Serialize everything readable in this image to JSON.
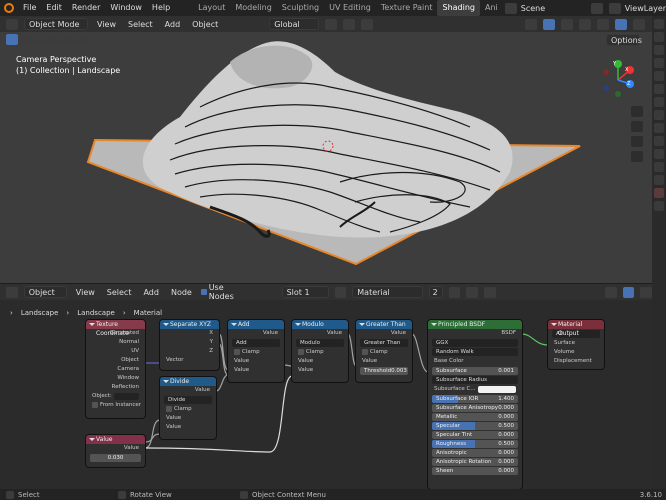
{
  "menubar": {
    "items": [
      "File",
      "Edit",
      "Render",
      "Window",
      "Help"
    ],
    "workspaces": [
      "Layout",
      "Modeling",
      "Sculpting",
      "UV Editing",
      "Texture Paint",
      "Shading",
      "Ani"
    ],
    "active_workspace": "Shading",
    "scene": "Scene",
    "view_layer": "ViewLayer"
  },
  "viewport_header": {
    "mode": "Object Mode",
    "menus": [
      "View",
      "Select",
      "Add",
      "Object"
    ],
    "transform": "Global",
    "options": "Options"
  },
  "viewport": {
    "camera": "Camera Perspective",
    "collection": "(1) Collection | Landscape",
    "gizmo_axes": [
      "X",
      "Y",
      "Z"
    ]
  },
  "node_header": {
    "type": "Object",
    "menus": [
      "View",
      "Select",
      "Add",
      "Node"
    ],
    "use_nodes": "Use Nodes",
    "slot": "Slot 1",
    "material": "Material",
    "users": "2"
  },
  "breadcrumb": [
    "Landscape",
    "Landscape",
    "Material"
  ],
  "nodes": {
    "texcoord": {
      "title": "Texture Coordinate",
      "outputs": [
        "Generated",
        "Normal",
        "UV",
        "Object",
        "Camera",
        "Window",
        "Reflection"
      ],
      "object_label": "Object:",
      "from_instancer": "From Instancer"
    },
    "sepxyz": {
      "title": "Separate XYZ",
      "outputs": [
        "X",
        "Y",
        "Z"
      ],
      "input": "Vector"
    },
    "divide": {
      "title": "Divide",
      "output": "Value",
      "op": "Divide",
      "clamp": "Clamp",
      "inputs": [
        "Value",
        "Value"
      ]
    },
    "add": {
      "title": "Add",
      "output": "Value",
      "op": "Add",
      "clamp": "Clamp",
      "inputs": [
        "Value",
        "Value"
      ]
    },
    "modulo": {
      "title": "Modulo",
      "output": "Value",
      "op": "Modulo",
      "clamp": "Clamp",
      "inputs": [
        "Value",
        "Value"
      ]
    },
    "greater": {
      "title": "Greater Than",
      "output": "Value",
      "op": "Greater Than",
      "clamp": "Clamp",
      "input": "Value",
      "threshold_label": "Threshold",
      "threshold": "0.003"
    },
    "value": {
      "title": "Value",
      "output": "Value",
      "value": "0.030"
    },
    "bsdf": {
      "title": "Principled BSDF",
      "output": "BSDF",
      "distribution": "GGX",
      "sss_method": "Random Walk",
      "rows": [
        {
          "label": "Base Color",
          "type": "socket"
        },
        {
          "label": "Subsurface",
          "value": "0.001",
          "fill": 0.0
        },
        {
          "label": "Subsurface Radius",
          "type": "select"
        },
        {
          "label": "Subsurface C...",
          "type": "color"
        },
        {
          "label": "Subsurface IOR",
          "value": "1.400",
          "fill": 0.3
        },
        {
          "label": "Subsurface Anisotropy",
          "value": "0.000",
          "fill": 0.0
        },
        {
          "label": "Metallic",
          "value": "0.000",
          "fill": 0.0
        },
        {
          "label": "Specular",
          "value": "0.500",
          "fill": 0.5
        },
        {
          "label": "Specular Tint",
          "value": "0.000",
          "fill": 0.0
        },
        {
          "label": "Roughness",
          "value": "0.500",
          "fill": 0.5
        },
        {
          "label": "Anisotropic",
          "value": "0.000",
          "fill": 0.0
        },
        {
          "label": "Anisotropic Rotation",
          "value": "0.000",
          "fill": 0.0
        },
        {
          "label": "Sheen",
          "value": "0.000",
          "fill": 0.0
        }
      ]
    },
    "output": {
      "title": "Material Output",
      "target": "All",
      "inputs": [
        "Surface",
        "Volume",
        "Displacement"
      ]
    }
  },
  "statusbar": {
    "select": "Select",
    "rotate": "Rotate View",
    "context": "Object Context Menu",
    "version": "3.6.10"
  }
}
